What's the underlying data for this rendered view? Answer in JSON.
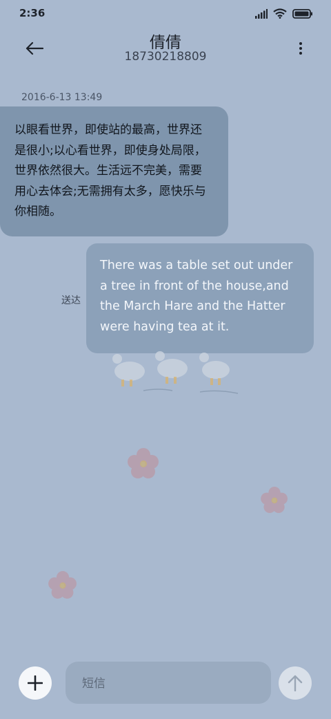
{
  "status_bar": {
    "time": "2:36",
    "icons": [
      "signal-icon",
      "wifi-icon",
      "battery-icon"
    ]
  },
  "header": {
    "contact_name": "倩倩",
    "contact_number": "18730218809",
    "icons": [
      "back-arrow-icon",
      "more-vertical-icon"
    ]
  },
  "conversation": {
    "timestamp": "2016-6-13 13:49",
    "messages": [
      {
        "direction": "incoming",
        "text": "以眼看世界，即使站的最高，世界还是很小;以心看世界，即使身处局限，世界依然很大。生活远不完美，需要用心去体会;无需拥有太多，愿快乐与你相随。"
      },
      {
        "direction": "outgoing",
        "text": "There was a table set out under a tree in front of the house,and the March Hare and the Hatter were having tea at it.",
        "status": "送达"
      }
    ]
  },
  "composer": {
    "placeholder": "短信",
    "icons": [
      "plus-icon",
      "send-arrow-icon"
    ]
  },
  "colors": {
    "background": "#a9b9cf",
    "incoming_bubble": "#7f95ad",
    "outgoing_bubble": "#8ca1b9",
    "input_field": "#9aabc0"
  }
}
